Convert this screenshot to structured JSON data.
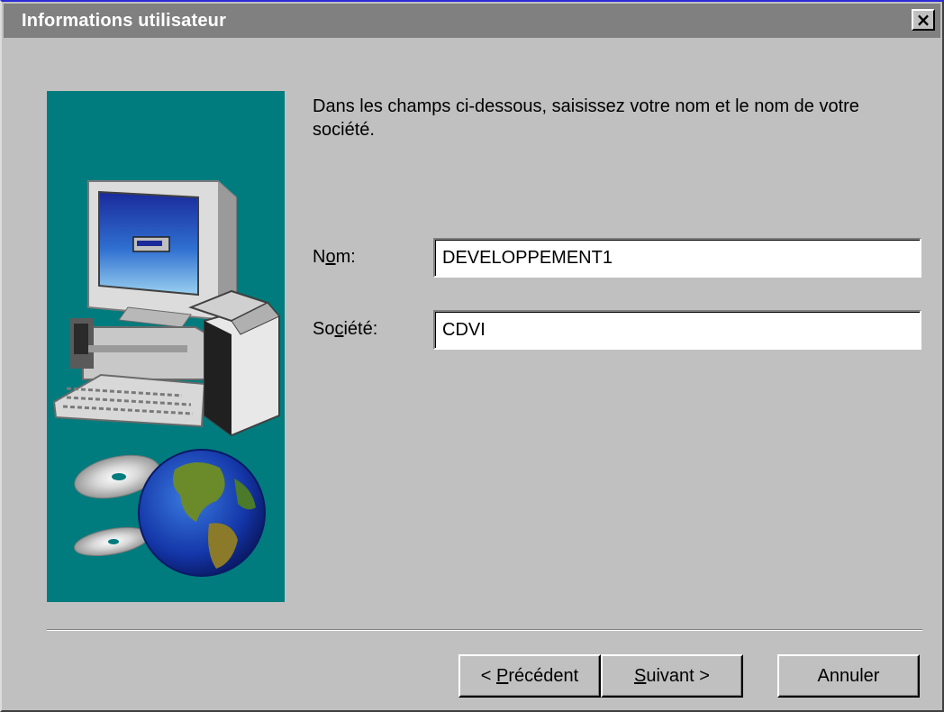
{
  "window": {
    "title": "Informations utilisateur",
    "close_label": "×"
  },
  "instruction": "Dans les champs ci-dessous, saisissez votre nom et le nom de votre société.",
  "fields": {
    "nom": {
      "label_pre": "N",
      "label_key": "o",
      "label_post": "m:",
      "value": "DEVELOPPEMENT1"
    },
    "societe": {
      "label_pre": "So",
      "label_key": "c",
      "label_post": "iété:",
      "value": "CDVI"
    }
  },
  "buttons": {
    "precedent": {
      "pre": "< ",
      "key": "P",
      "post": "récédent"
    },
    "suivant": {
      "pre": "",
      "key": "S",
      "post": "uivant >"
    },
    "annuler": {
      "label": "Annuler"
    }
  },
  "colors": {
    "title_bar": "#808080",
    "dialog_bg": "#c0c0c0",
    "illustration_bg": "#007b7e"
  },
  "icons": {
    "illustration": "computer-with-box-globe-and-cds"
  }
}
